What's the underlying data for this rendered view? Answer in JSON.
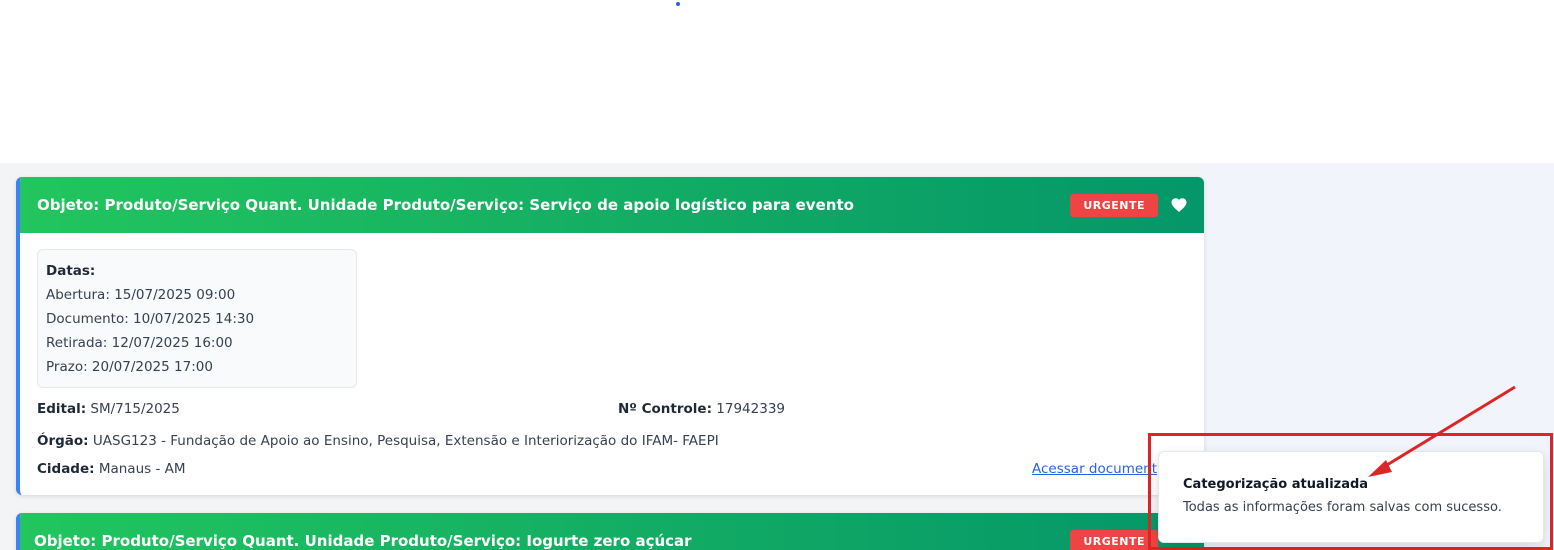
{
  "colors": {
    "accent": "#2563eb",
    "header_start": "#22c55e",
    "header_end": "#059669",
    "urgent": "#ef4444",
    "highlight": "#dc2626"
  },
  "cards": [
    {
      "title": "Objeto: Produto/Serviço Quant. Unidade Produto/Serviço: Serviço de apoio logístico para evento",
      "badge": "URGENTE",
      "favorite_icon": "heart-icon",
      "dates_heading": "Datas:",
      "dates": [
        {
          "label": "Abertura:",
          "value": "15/07/2025 09:00"
        },
        {
          "label": "Documento:",
          "value": "10/07/2025 14:30"
        },
        {
          "label": "Retirada:",
          "value": "12/07/2025 16:00"
        },
        {
          "label": "Prazo:",
          "value": "20/07/2025 17:00"
        }
      ],
      "edital_label": "Edital:",
      "edital_value": "SM/715/2025",
      "controle_label": "Nº Controle:",
      "controle_value": "17942339",
      "orgao_label": "Órgão:",
      "orgao_value": "UASG123 - Fundação de Apoio ao Ensino, Pesquisa, Extensão e Interiorização do IFAM- FAEPI",
      "cidade_label": "Cidade:",
      "cidade_value": "Manaus - AM",
      "link": "Acessar document"
    },
    {
      "title": "Objeto: Produto/Serviço Quant. Unidade Produto/Serviço: Iogurte zero açúcar",
      "badge": "URGENTE"
    }
  ],
  "toast": {
    "title": "Categorização atualizada",
    "message": "Todas as informações foram salvas com sucesso."
  }
}
